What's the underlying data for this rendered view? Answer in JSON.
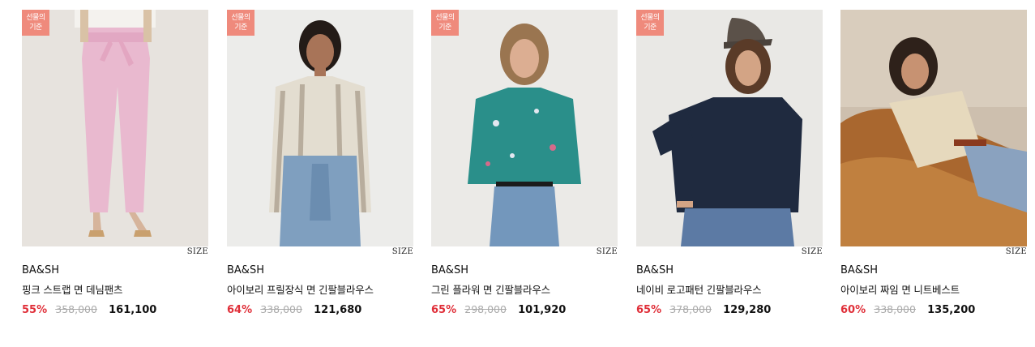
{
  "gift_badge": [
    "선물의",
    "기준"
  ],
  "size_label": "SIZE",
  "products": [
    {
      "brand": "BA&SH",
      "name": "핑크 스트랩 면 데님팬츠",
      "discount": "55%",
      "original_price": "358,000",
      "sale_price": "161,100",
      "has_gift_badge": true,
      "image": "product-photo-pink-pants"
    },
    {
      "brand": "BA&SH",
      "name": "아이보리 프릴장식 면 긴팔블라우스",
      "discount": "64%",
      "original_price": "338,000",
      "sale_price": "121,680",
      "has_gift_badge": true,
      "image": "product-photo-ivory-blouse"
    },
    {
      "brand": "BA&SH",
      "name": "그린 플라워 면 긴팔블라우스",
      "discount": "65%",
      "original_price": "298,000",
      "sale_price": "101,920",
      "has_gift_badge": true,
      "image": "product-photo-green-blouse"
    },
    {
      "brand": "BA&SH",
      "name": "네이비 로고패턴 긴팔블라우스",
      "discount": "65%",
      "original_price": "378,000",
      "sale_price": "129,280",
      "has_gift_badge": true,
      "image": "product-photo-navy-blouse"
    },
    {
      "brand": "BA&SH",
      "name": "아이보리 짜임 면 니트베스트",
      "discount": "60%",
      "original_price": "338,000",
      "sale_price": "135,200",
      "has_gift_badge": false,
      "image": "product-photo-knit-vest"
    }
  ],
  "colors": {
    "discount": "#e0303a",
    "gift_badge_bg": "#ef8a7c",
    "original_price": "#aaaaaa"
  }
}
